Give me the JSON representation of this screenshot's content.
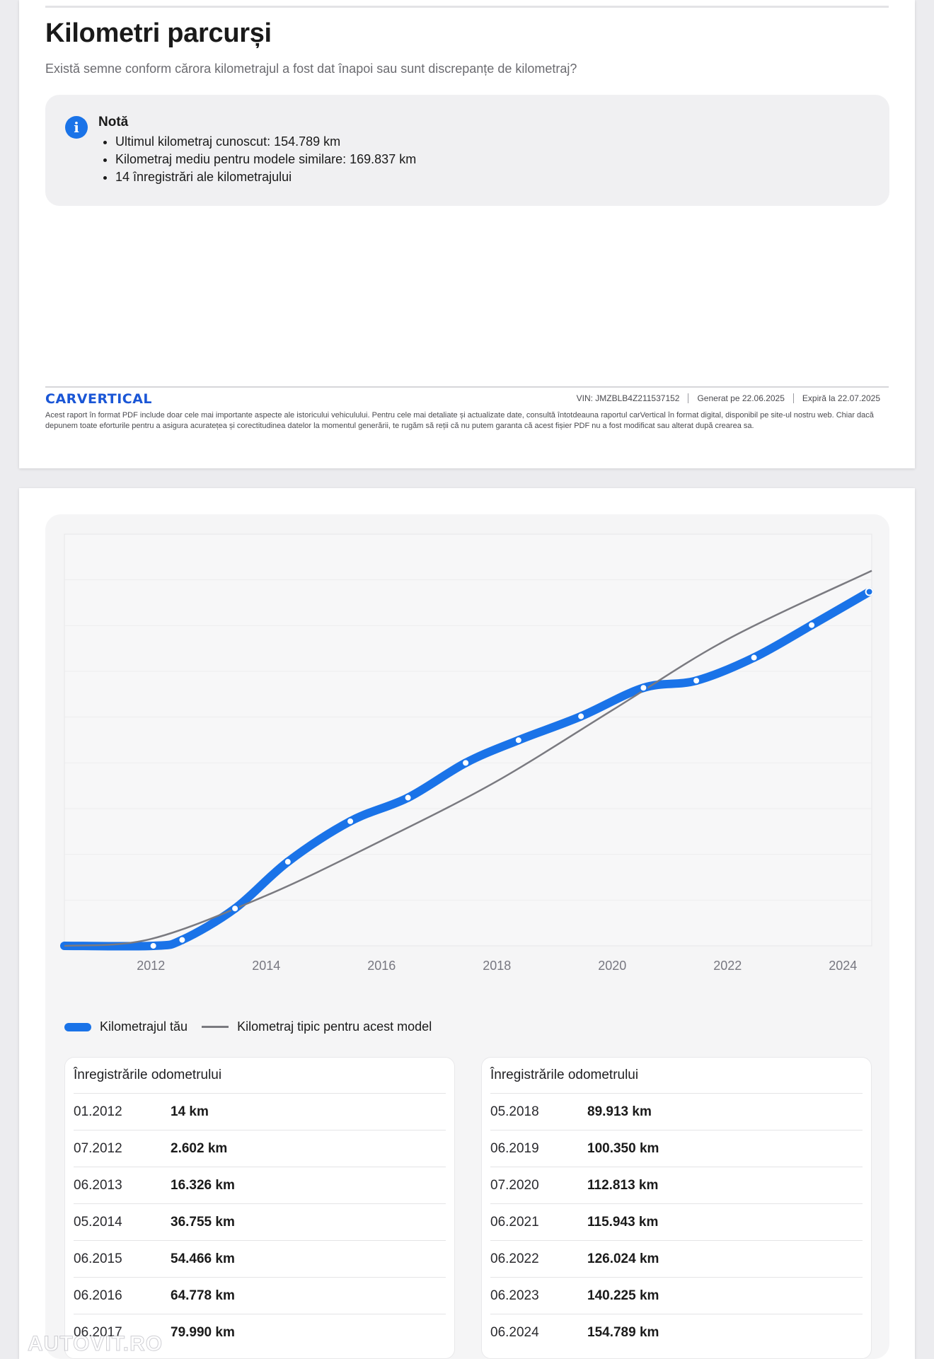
{
  "section": {
    "title": "Kilometri parcurși",
    "subtitle": "Există semne conform cărora kilometrajul a fost dat înapoi sau sunt discrepanțe de kilometraj?"
  },
  "note": {
    "icon": "info-icon",
    "title": "Notă",
    "items": [
      "Ultimul kilometraj cunoscut: 154.789 km",
      "Kilometraj mediu pentru modele similare: 169.837 km",
      "14 înregistrări ale kilometrajului"
    ]
  },
  "footer": {
    "logo": "CARVERTICAL",
    "vin": "VIN:  JMZBLB4Z211537152",
    "generated": "Generat pe  22.06.2025",
    "expires": "Expiră la  22.07.2025",
    "disclaimer": "Acest raport în format PDF include doar cele mai importante aspecte ale istoricului vehiculului. Pentru cele mai detaliate și actualizate date, consultă întotdeauna raportul carVertical în format digital, disponibil pe site-ul nostru web. Chiar dacă depunem toate eforturile pentru a asigura acuratețea și corectitudinea datelor la momentul generării, te rugăm să reții că nu putem garanta că acest fișier PDF nu a fost modificat sau alterat după crearea sa."
  },
  "chart_data": {
    "type": "line",
    "x_tick_labels": [
      "2012",
      "2014",
      "2016",
      "2018",
      "2020",
      "2022",
      "2024"
    ],
    "xlim": [
      2010.5,
      2024.5
    ],
    "ylim": [
      0,
      180000
    ],
    "grid": true,
    "legend": "bottom-left",
    "series": [
      {
        "name": "Kilometrajul tău",
        "color": "#1a73e8",
        "points": [
          {
            "x": "01.2012",
            "y": 14
          },
          {
            "x": "07.2012",
            "y": 2602
          },
          {
            "x": "06.2013",
            "y": 16326
          },
          {
            "x": "05.2014",
            "y": 36755
          },
          {
            "x": "06.2015",
            "y": 54466
          },
          {
            "x": "06.2016",
            "y": 64778
          },
          {
            "x": "06.2017",
            "y": 79990
          },
          {
            "x": "05.2018",
            "y": 89913
          },
          {
            "x": "06.2019",
            "y": 100350
          },
          {
            "x": "07.2020",
            "y": 112813
          },
          {
            "x": "06.2021",
            "y": 115943
          },
          {
            "x": "06.2022",
            "y": 126024
          },
          {
            "x": "06.2023",
            "y": 140225
          },
          {
            "x": "06.2024",
            "y": 154789
          }
        ]
      },
      {
        "name": "Kilometraj tipic pentru acest model",
        "color": "#7a7a80",
        "points": [
          {
            "x": 2010.5,
            "y": 0
          },
          {
            "x": 2012,
            "y": 3000
          },
          {
            "x": 2014,
            "y": 22000
          },
          {
            "x": 2016,
            "y": 46000
          },
          {
            "x": 2018,
            "y": 72000
          },
          {
            "x": 2020,
            "y": 103000
          },
          {
            "x": 2022,
            "y": 134000
          },
          {
            "x": 2024.5,
            "y": 164000
          }
        ]
      }
    ]
  },
  "records": {
    "title": "Înregistrările odometrului",
    "left": [
      {
        "date": "01.2012",
        "km": "14 km"
      },
      {
        "date": "07.2012",
        "km": "2.602 km"
      },
      {
        "date": "06.2013",
        "km": "16.326 km"
      },
      {
        "date": "05.2014",
        "km": "36.755 km"
      },
      {
        "date": "06.2015",
        "km": "54.466 km"
      },
      {
        "date": "06.2016",
        "km": "64.778 km"
      },
      {
        "date": "06.2017",
        "km": "79.990 km"
      }
    ],
    "right": [
      {
        "date": "05.2018",
        "km": "89.913 km"
      },
      {
        "date": "06.2019",
        "km": "100.350 km"
      },
      {
        "date": "07.2020",
        "km": "112.813 km"
      },
      {
        "date": "06.2021",
        "km": "115.943 km"
      },
      {
        "date": "06.2022",
        "km": "126.024 km"
      },
      {
        "date": "06.2023",
        "km": "140.225 km"
      },
      {
        "date": "06.2024",
        "km": "154.789 km"
      }
    ]
  },
  "watermark": "AUTOVIT.RO"
}
